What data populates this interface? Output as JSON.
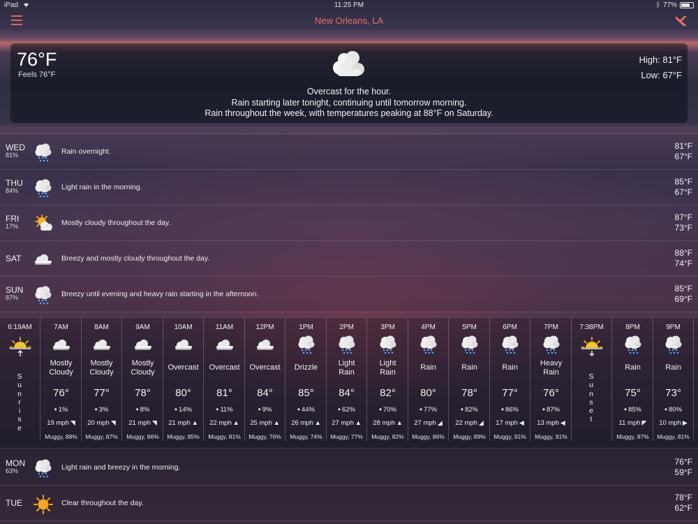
{
  "status_bar": {
    "device": "iPad",
    "time": "11:25 PM",
    "battery_pct": "77%",
    "battery_level": 0.77
  },
  "nav": {
    "location": "New Orleans, LA"
  },
  "current": {
    "temp": "76°F",
    "feels": "Feels 76°F",
    "icon": "cloud-icon",
    "high": "High: 81°F",
    "low": "Low: 67°F",
    "summary_1": "Overcast for the hour.",
    "summary_2": "Rain starting later tonight, continuing until tomorrow morning.",
    "summary_3": "Rain throughout the week, with temperatures peaking at 88°F on Saturday."
  },
  "days_top": [
    {
      "day": "WED",
      "precip": "81%",
      "icon": "rain-icon",
      "summary": "Rain overnight.",
      "high": "81°F",
      "low": "67°F"
    },
    {
      "day": "THU",
      "precip": "84%",
      "icon": "rain-icon",
      "summary": "Light rain in the morning.",
      "high": "85°F",
      "low": "67°F"
    },
    {
      "day": "FRI",
      "precip": "17%",
      "icon": "partly-cloudy-icon",
      "summary": "Mostly cloudy throughout the day.",
      "high": "87°F",
      "low": "73°F"
    },
    {
      "day": "SAT",
      "precip": "",
      "icon": "wind-icon",
      "summary": "Breezy and mostly cloudy throughout the day.",
      "high": "88°F",
      "low": "74°F"
    },
    {
      "day": "SUN",
      "precip": "87%",
      "icon": "rain-icon",
      "summary": "Breezy until evening and heavy rain starting in the afternoon.",
      "high": "85°F",
      "low": "69°F"
    }
  ],
  "hourly": [
    {
      "kind": "event",
      "time": "6:19AM",
      "label": "Sunrise",
      "icon": "sunrise-icon"
    },
    {
      "kind": "hour",
      "time": "7AM",
      "icon": "wind-icon",
      "cond": "Mostly Cloudy",
      "temp": "76°",
      "precip": "1%",
      "wind": "19 mph",
      "arrow": "◥",
      "muggy": "Muggy, 88%"
    },
    {
      "kind": "hour",
      "time": "8AM",
      "icon": "wind-icon",
      "cond": "Mostly Cloudy",
      "temp": "77°",
      "precip": "3%",
      "wind": "20 mph",
      "arrow": "◥",
      "muggy": "Muggy, 87%"
    },
    {
      "kind": "hour",
      "time": "9AM",
      "icon": "wind-icon",
      "cond": "Mostly Cloudy",
      "temp": "78°",
      "precip": "8%",
      "wind": "21 mph",
      "arrow": "◥",
      "muggy": "Muggy, 86%"
    },
    {
      "kind": "hour",
      "time": "10AM",
      "icon": "wind-icon",
      "cond": "Overcast",
      "temp": "80°",
      "precip": "14%",
      "wind": "21 mph",
      "arrow": "▲",
      "muggy": "Muggy, 85%"
    },
    {
      "kind": "hour",
      "time": "11AM",
      "icon": "wind-icon",
      "cond": "Overcast",
      "temp": "81°",
      "precip": "11%",
      "wind": "22 mph",
      "arrow": "▲",
      "muggy": "Muggy, 81%"
    },
    {
      "kind": "hour",
      "time": "12PM",
      "icon": "wind-icon",
      "cond": "Overcast",
      "temp": "84°",
      "precip": "9%",
      "wind": "25 mph",
      "arrow": "▲",
      "muggy": "Muggy, 76%"
    },
    {
      "kind": "hour",
      "time": "1PM",
      "icon": "rain-icon",
      "cond": "Drizzle",
      "temp": "85°",
      "precip": "44%",
      "wind": "26 mph",
      "arrow": "▲",
      "muggy": "Muggy, 74%"
    },
    {
      "kind": "hour",
      "time": "2PM",
      "icon": "rain-icon",
      "cond": "Light Rain",
      "temp": "84°",
      "precip": "62%",
      "wind": "27 mph",
      "arrow": "▲",
      "muggy": "Muggy, 77%"
    },
    {
      "kind": "hour",
      "time": "3PM",
      "icon": "rain-icon",
      "cond": "Light Rain",
      "temp": "82°",
      "precip": "70%",
      "wind": "28 mph",
      "arrow": "▲",
      "muggy": "Muggy, 82%"
    },
    {
      "kind": "hour",
      "time": "4PM",
      "icon": "rain-icon",
      "cond": "Rain",
      "temp": "80°",
      "precip": "77%",
      "wind": "27 mph",
      "arrow": "◢",
      "muggy": "Muggy, 86%"
    },
    {
      "kind": "hour",
      "time": "5PM",
      "icon": "rain-icon",
      "cond": "Rain",
      "temp": "78°",
      "precip": "82%",
      "wind": "22 mph",
      "arrow": "◢",
      "muggy": "Muggy, 89%"
    },
    {
      "kind": "hour",
      "time": "6PM",
      "icon": "rain-icon",
      "cond": "Rain",
      "temp": "77°",
      "precip": "86%",
      "wind": "17 mph",
      "arrow": "◀",
      "muggy": "Muggy, 91%"
    },
    {
      "kind": "hour",
      "time": "7PM",
      "icon": "rain-icon",
      "cond": "Heavy Rain",
      "temp": "76°",
      "precip": "87%",
      "wind": "13 mph",
      "arrow": "◀",
      "muggy": "Muggy, 91%"
    },
    {
      "kind": "event",
      "time": "7:38PM",
      "label": "Sunset",
      "icon": "sunset-icon"
    },
    {
      "kind": "hour",
      "time": "8PM",
      "icon": "rain-icon",
      "cond": "Rain",
      "temp": "75°",
      "precip": "85%",
      "wind": "11 mph",
      "arrow": "◤",
      "muggy": "Muggy, 87%"
    },
    {
      "kind": "hour",
      "time": "9PM",
      "icon": "rain-icon",
      "cond": "Rain",
      "temp": "73°",
      "precip": "80%",
      "wind": "10 mph",
      "arrow": "▶",
      "muggy": "Muggy, 81%"
    }
  ],
  "days_bottom": [
    {
      "day": "MON",
      "precip": "63%",
      "icon": "rain-icon",
      "summary": "Light rain and breezy in the morning.",
      "high": "76°F",
      "low": "59°F"
    },
    {
      "day": "TUE",
      "precip": "",
      "icon": "sun-icon",
      "summary": "Clear throughout the day.",
      "high": "78°F",
      "low": "62°F"
    }
  ]
}
